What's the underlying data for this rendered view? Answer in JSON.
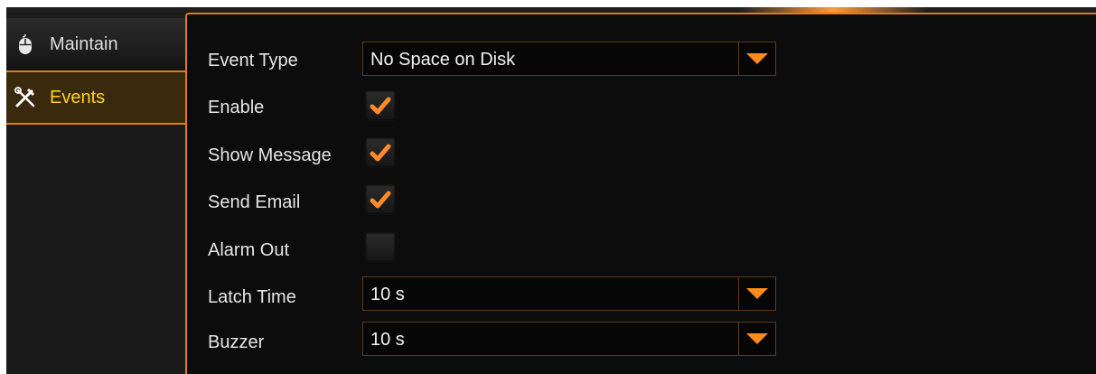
{
  "sidebar": {
    "items": [
      {
        "label": "Maintain",
        "icon": "mouse-icon",
        "selected": false
      },
      {
        "label": "Events",
        "icon": "tools-icon",
        "selected": true
      }
    ]
  },
  "form": {
    "event_type": {
      "label": "Event Type",
      "value": "No Space on Disk"
    },
    "enable": {
      "label": "Enable",
      "checked": true
    },
    "show_message": {
      "label": "Show Message",
      "checked": true
    },
    "send_email": {
      "label": "Send Email",
      "checked": true
    },
    "alarm_out": {
      "label": "Alarm Out",
      "checked": false
    },
    "latch_time": {
      "label": "Latch Time",
      "value": "10 s"
    },
    "buzzer": {
      "label": "Buzzer",
      "value": "10 s"
    }
  },
  "colors": {
    "accent": "#e07a1c",
    "selected_text": "#ffd21f",
    "background": "#0c0c0c"
  }
}
